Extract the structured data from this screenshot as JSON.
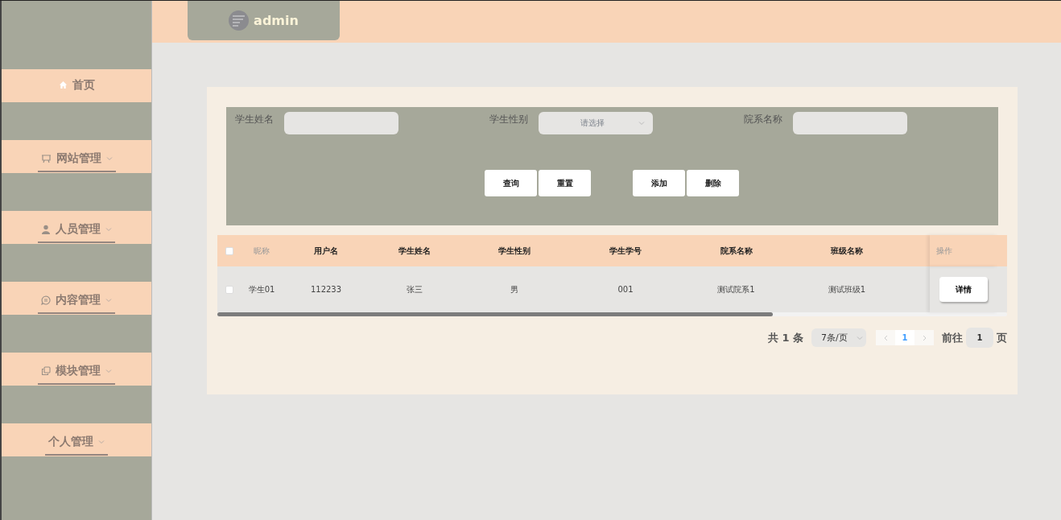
{
  "header": {
    "user": "admin"
  },
  "sidebar": {
    "items": [
      {
        "label": "首页",
        "expandable": false
      },
      {
        "label": "网站管理",
        "expandable": true
      },
      {
        "label": "人员管理",
        "expandable": true
      },
      {
        "label": "内容管理",
        "expandable": true
      },
      {
        "label": "模块管理",
        "expandable": true
      },
      {
        "label": "个人管理",
        "expandable": true
      }
    ]
  },
  "search": {
    "fields": [
      {
        "label": "学生姓名",
        "kind": "text"
      },
      {
        "label": "学生性别",
        "kind": "select",
        "placeholder": "请选择"
      },
      {
        "label": "院系名称",
        "kind": "text"
      }
    ],
    "buttons": [
      [
        "查询",
        "重置"
      ],
      [
        "添加",
        "删除"
      ]
    ]
  },
  "table": {
    "select_all": {
      "checked": false
    },
    "columns": [
      "昵称",
      "用户名",
      "学生姓名",
      "学生性别",
      "学生学号",
      "院系名称",
      "班级名称"
    ],
    "action_column": "操作",
    "rows": [
      {
        "checked": false,
        "cells": [
          "学生01",
          "112233",
          "张三",
          "男",
          "001",
          "测试院系1",
          "测试班级1"
        ],
        "action": "详情"
      }
    ]
  },
  "pagination": {
    "total": "共 1 条",
    "page_size": "7条/页",
    "pages": [
      {
        "label": "1",
        "selected": true
      }
    ],
    "goto_label": "前往",
    "goto_value": "1",
    "goto_suffix": "页"
  }
}
